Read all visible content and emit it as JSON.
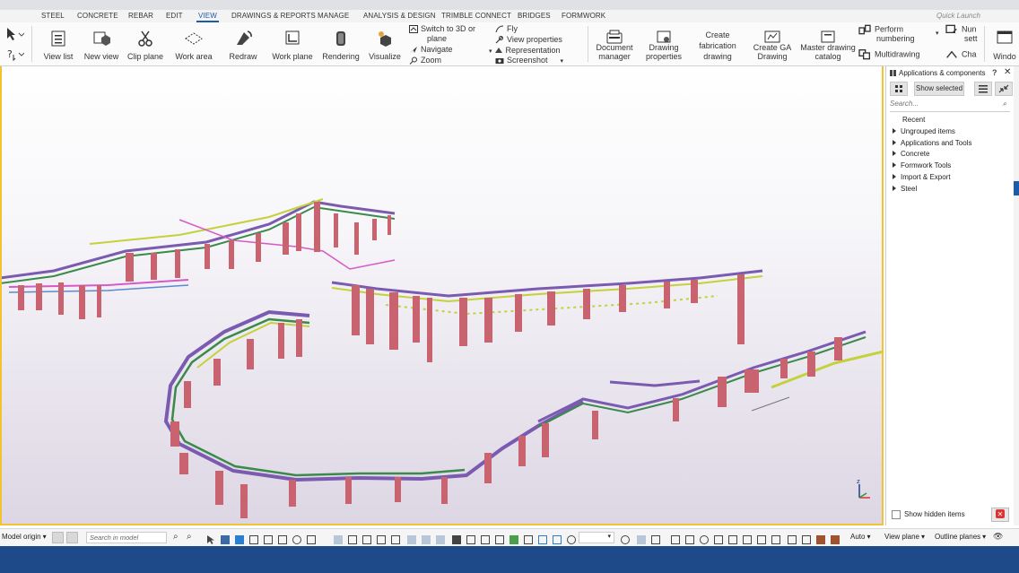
{
  "menu": {
    "tabs": [
      "STEEL",
      "CONCRETE",
      "REBAR",
      "EDIT",
      "VIEW",
      "DRAWINGS & REPORTS",
      "MANAGE",
      "ANALYSIS & DESIGN",
      "TRIMBLE CONNECT",
      "BRIDGES",
      "FORMWORK"
    ],
    "active_tab": "VIEW",
    "quick_launch_placeholder": "Quick Launch"
  },
  "ribbon": {
    "view_list": "View list",
    "new_view": "New view",
    "clip_plane": "Clip plane",
    "work_area": "Work area",
    "redraw": "Redraw",
    "work_plane": "Work plane",
    "rendering": "Rendering",
    "visualize": "Visualize",
    "switch_3d_line1": "Switch to 3D or",
    "switch_3d_line2": "plane",
    "navigate": "Navigate",
    "zoom": "Zoom",
    "fly": "Fly",
    "view_properties": "View properties",
    "representation": "Representation",
    "screenshot": "Screenshot",
    "document_manager_line1": "Document",
    "document_manager_line2": "manager",
    "drawing_properties_line1": "Drawing",
    "drawing_properties_line2": "properties",
    "create_fab_line1": "Create",
    "create_fab_line2": "fabrication",
    "create_fab_line3": "drawing",
    "create_ga_line1": "Create GA",
    "create_ga_line2": "Drawing",
    "master_catalog_line1": "Master drawing",
    "master_catalog_line2": "catalog",
    "perform_numbering_line1": "Perform",
    "perform_numbering_line2": "numbering",
    "multidrawing": "Multidrawing",
    "num_settings_line1": "Nun",
    "num_settings_line2": "sett",
    "change": "Cha",
    "window": "Windo"
  },
  "panel": {
    "title": "Applications & components",
    "help": "?",
    "show_selected": "Show selected",
    "search_placeholder": "Search...",
    "recent": "Recent",
    "groups": [
      "Ungrouped items",
      "Applications and Tools",
      "Concrete",
      "Formwork Tools",
      "Import & Export",
      "Steel"
    ],
    "show_hidden": "Show hidden items"
  },
  "bottombar": {
    "model_origin": "Model origin",
    "search_placeholder": "Search in model",
    "auto": "Auto",
    "view_plane": "View plane",
    "outline_planes": "Outline planes"
  },
  "axes": {
    "z": "z"
  },
  "colors": {
    "accent": "#1d5aa8",
    "viewport_border": "#f2c230",
    "column_pink": "#c9636f",
    "statusbar": "#1e4a8a"
  }
}
